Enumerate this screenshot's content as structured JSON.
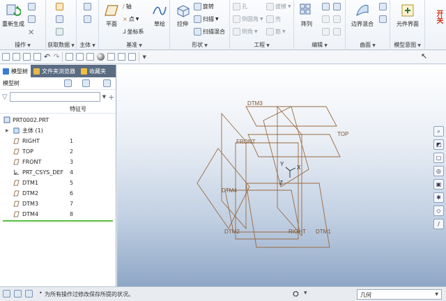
{
  "ribbon": {
    "operations": {
      "label": "操作",
      "regenerate": "重新生成"
    },
    "get_data": {
      "label": "获取数据"
    },
    "body": {
      "label": "主体"
    },
    "datum": {
      "label": "基准",
      "plane": "平面",
      "axis": "轴",
      "point": "点",
      "csys": "坐标系",
      "sketch": "草绘"
    },
    "shapes": {
      "label": "形状",
      "extrude": "拉伸",
      "revolve": "旋转",
      "sweep": "扫描",
      "swept_blend": "扫描混合"
    },
    "engineering": {
      "label": "工程",
      "hole": "孔",
      "round": "倒圆角",
      "chamfer": "倒角",
      "draft": "拔模",
      "shell": "壳",
      "rib": "筋"
    },
    "editing": {
      "label": "编辑",
      "pattern": "阵列"
    },
    "surfaces": {
      "label": "曲面",
      "boundary_blend": "边界混合"
    },
    "model_intent": {
      "label": "模型意图",
      "component_interface": "元件界面"
    },
    "switch": "开关"
  },
  "left_panel": {
    "tabs": [
      "模型树",
      "文件夹浏览器",
      "收藏夹"
    ],
    "tree_title": "模型树",
    "col_feature_id": "特征号",
    "root": "PRT0002.PRT",
    "items": [
      {
        "name": "主体 (1)",
        "id": ""
      },
      {
        "name": "RIGHT",
        "id": "1"
      },
      {
        "name": "TOP",
        "id": "2"
      },
      {
        "name": "FRONT",
        "id": "3"
      },
      {
        "name": "PRT_CSYS_DEF",
        "id": "4"
      },
      {
        "name": "DTM1",
        "id": "5"
      },
      {
        "name": "DTM2",
        "id": "6"
      },
      {
        "name": "DTM3",
        "id": "7"
      },
      {
        "name": "DTM4",
        "id": "8"
      }
    ]
  },
  "viewport": {
    "plane_labels": {
      "dtm3": "DTM3",
      "top": "TOP",
      "front": "FRONT",
      "dtm4": "DTM4",
      "dtm2": "DTM2",
      "right": "RIGHT",
      "dtm1": "DTM1"
    },
    "axis_labels": {
      "x": "X",
      "y": "Y",
      "z": "Z"
    },
    "colors": {
      "plane": "#9a6a40",
      "csys": "#222222"
    }
  },
  "status": {
    "message": "为所有操作过修改保存所提的状况。",
    "filter_value": "几何"
  }
}
